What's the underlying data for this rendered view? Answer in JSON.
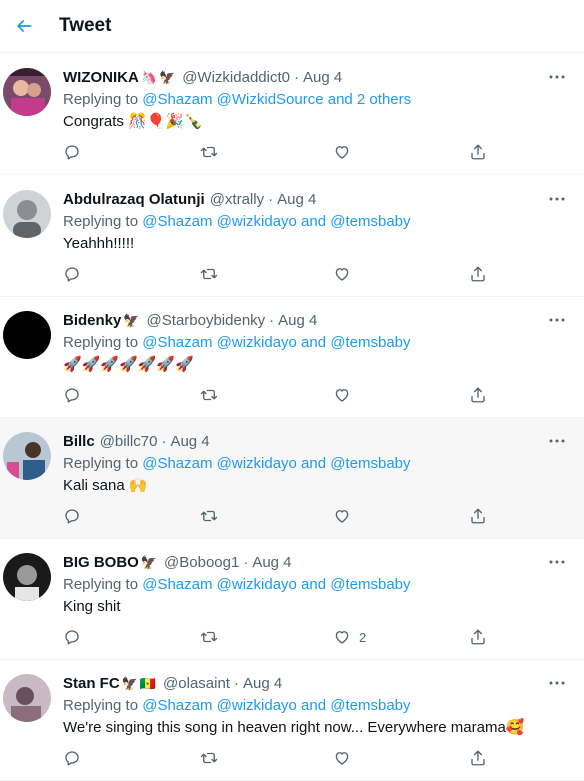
{
  "header": {
    "title": "Tweet",
    "back_icon": "arrow-left-icon"
  },
  "colors": {
    "link": "#1d9bf0",
    "muted": "#536471",
    "text": "#0f1419",
    "divider": "#eff3f4",
    "highlight": "#f7f7f7"
  },
  "replying_prefix": "Replying to",
  "tweets": [
    {
      "name": "WIZONIKA",
      "badges": [
        "🦄",
        "🦅"
      ],
      "handle": "@Wizkidaddict0",
      "time": "Aug 4",
      "replying_to": "@Shazam @WizkidSource and 2 others",
      "text": "Congrats 🎊🎈🎉🍾",
      "likes": "",
      "avatar": "photo-avatar"
    },
    {
      "name": "Abdulrazaq Olatunji",
      "badges": [],
      "handle": "@xtrally",
      "time": "Aug 4",
      "replying_to": "@Shazam @wizkidayo and @temsbaby",
      "text": "Yeahhh!!!!!",
      "likes": "",
      "avatar": "photo-avatar"
    },
    {
      "name": "Bidenky",
      "badges": [
        "🦅"
      ],
      "handle": "@Starboybidenky",
      "time": "Aug 4",
      "replying_to": "@Shazam @wizkidayo and @temsbaby",
      "text": "🚀🚀🚀🚀🚀🚀🚀",
      "likes": "",
      "avatar": "black-avatar"
    },
    {
      "name": "Billc",
      "badges": [],
      "handle": "@billc70",
      "time": "Aug 4",
      "replying_to": "@Shazam @wizkidayo and @temsbaby",
      "text": "Kali sana 🙌",
      "likes": "",
      "avatar": "photo-avatar"
    },
    {
      "name": "BIG BOBO",
      "badges": [
        "🦅"
      ],
      "handle": "@Boboog1",
      "time": "Aug 4",
      "replying_to": "@Shazam @wizkidayo and @temsbaby",
      "text": "King shit",
      "likes": "2",
      "avatar": "photo-avatar"
    },
    {
      "name": "Stan FC",
      "badges": [
        "🦅",
        "🇸🇳"
      ],
      "handle": "@olasaint",
      "time": "Aug 4",
      "replying_to": "@Shazam @wizkidayo and @temsbaby",
      "text": "We're singing this song in heaven right now... Everywhere marama🥰",
      "likes": "",
      "avatar": "photo-avatar"
    }
  ],
  "action_icons": [
    "reply-icon",
    "retweet-icon",
    "like-icon",
    "share-icon"
  ]
}
